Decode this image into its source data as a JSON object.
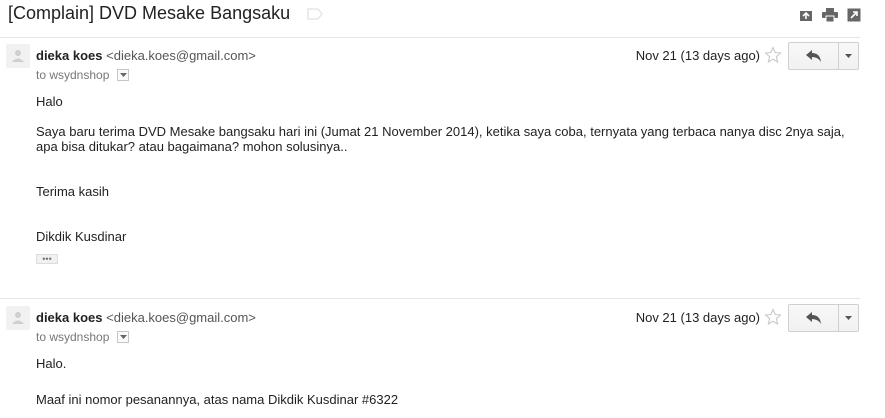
{
  "thread": {
    "subject": "[Complain] DVD Mesake Bangsaku",
    "icons": [
      "archive-icon",
      "print-icon",
      "new-window-icon"
    ]
  },
  "messages": [
    {
      "sender_name": "dieka koes",
      "sender_email": "<dieka.koes@gmail.com>",
      "to_text": "to wsydnshop",
      "date": "Nov 21 (13 days ago)",
      "body": {
        "greeting": "Halo",
        "para1_line1": "Saya baru terima DVD Mesake bangsaku hari ini (Jumat 21 November 2014), ketika saya coba, ternyata yang terbaca nanya disc 2nya saja,",
        "para1_line2": "apa bisa ditukar? atau bagaimana? mohon solusinya..",
        "thanks": "Terima kasih",
        "signature": "Dikdik Kusdinar"
      },
      "ellipsis": "•••"
    },
    {
      "sender_name": "dieka koes",
      "sender_email": "<dieka.koes@gmail.com>",
      "to_text": "to wsydnshop",
      "date": "Nov 21 (13 days ago)",
      "body": {
        "greeting": "Halo.",
        "line1": "Maaf ini nomor pesanannya, atas nama Dikdik Kusdinar  #6322"
      }
    }
  ],
  "colors": {
    "text": "#222222",
    "muted": "#777777",
    "border": "#d0d0d0",
    "icon": "#666666"
  }
}
